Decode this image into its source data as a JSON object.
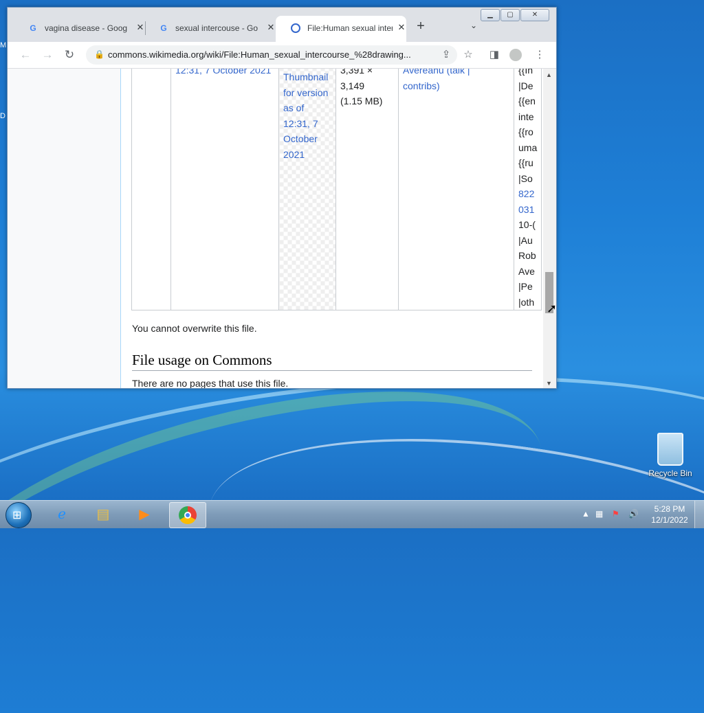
{
  "desktop": {
    "edge_labels": [
      "M",
      "D"
    ],
    "recycle_bin_label": "Recycle Bin"
  },
  "browser": {
    "tabs": [
      {
        "title": "vagina disease - Googl",
        "favicon": "G"
      },
      {
        "title": "sexual intercouse - Goo",
        "favicon": "G"
      },
      {
        "title": "File:Human sexual inter",
        "favicon": "wikimedia-icon",
        "active": true
      }
    ],
    "new_tab_label": "+",
    "tab_search_icon": "chevron-down-icon",
    "window_buttons": [
      "minimize-icon",
      "maximize-icon",
      "close-icon"
    ],
    "url": "commons.wikimedia.org/wiki/File:Human_sexual_intercourse_%28drawing..."
  },
  "page": {
    "history_row": {
      "datetime": "12:31, 7 October 2021",
      "thumbnail_alt": "Thumbnail for version as of 12:31, 7 October 2021",
      "dimensions": "3,391 × 3,149",
      "size": "(1.15 MB)",
      "user": "Avereanu",
      "user_links": "(talk | contribs)",
      "comment_lines": [
        "{{In",
        "|De",
        "{{en",
        "inte",
        "{{ro",
        "uma",
        "{{ru",
        "|So",
        "822",
        "031",
        "10-(",
        "|Au",
        "Rob",
        "Ave",
        "|Pe",
        "|oth"
      ]
    },
    "overwrite_note": "You cannot overwrite this file.",
    "usage_heading": "File usage on Commons",
    "usage_text": "There are no pages that use this file."
  },
  "taskbar": {
    "clock_time": "5:28 PM",
    "clock_date": "12/1/2022"
  }
}
